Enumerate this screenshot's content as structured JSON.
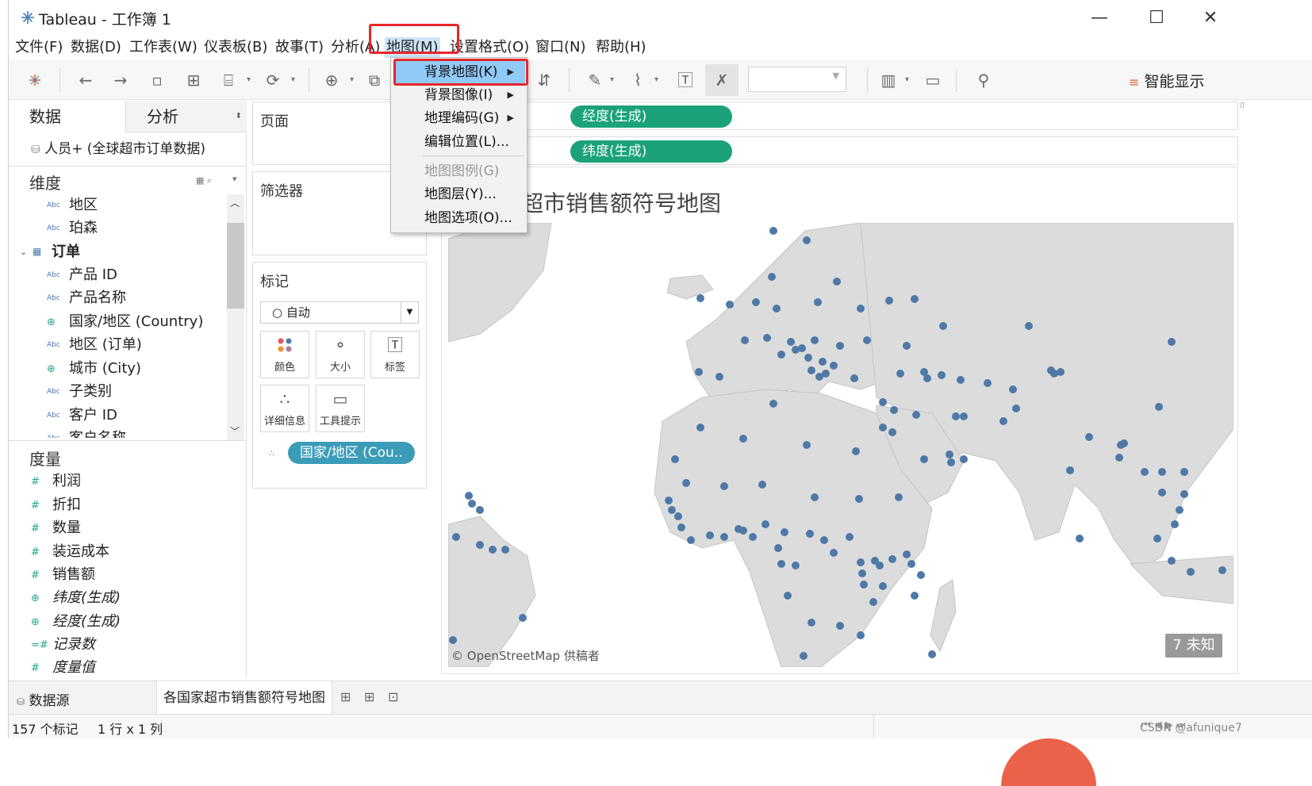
{
  "window": {
    "title": "Tableau - 工作簿 1",
    "controls": {
      "minimize": "—",
      "maximize": "☐",
      "close": "✕"
    }
  },
  "menubar": {
    "items": [
      "文件(F)",
      "数据(D)",
      "工作表(W)",
      "仪表板(B)",
      "故事(T)",
      "分析(A)",
      "地图(M)",
      "设置格式(O)",
      "窗口(N)",
      "帮助(H)"
    ],
    "active": "地图(M)"
  },
  "toolbar": {
    "smart_display": "智能显示",
    "icons": [
      "tableau-logo-icon",
      "undo-icon",
      "redo-icon",
      "save-icon",
      "new-datasource-icon",
      "pause-updates-icon",
      "refresh-icon",
      "new-worksheet-icon",
      "duplicate-icon",
      "sort-desc-icon",
      "highlight-icon",
      "paperclip-icon",
      "text-label-icon",
      "clear-pin-icon",
      "fit-dropdown",
      "show-cards-icon",
      "presentation-icon",
      "share-icon"
    ]
  },
  "map_menu": {
    "items": [
      {
        "label": "背景地图(K)",
        "submenu": true,
        "highlighted": true,
        "disabled": false
      },
      {
        "label": "背景图像(I)",
        "submenu": true,
        "highlighted": false,
        "disabled": false
      },
      {
        "label": "地理编码(G)",
        "submenu": true,
        "highlighted": false,
        "disabled": false
      },
      {
        "label": "编辑位置(L)...",
        "submenu": false,
        "highlighted": false,
        "disabled": false
      },
      {
        "label": "地图图例(G)",
        "submenu": false,
        "highlighted": false,
        "disabled": true
      },
      {
        "label": "地图层(Y)...",
        "submenu": false,
        "highlighted": false,
        "disabled": false
      },
      {
        "label": "地图选项(O)...",
        "submenu": false,
        "highlighted": false,
        "disabled": false
      }
    ]
  },
  "data_pane": {
    "tabs": [
      "数据",
      "分析"
    ],
    "datasource": "人员+ (全球超市订单数据)",
    "dimensions_title": "维度",
    "dimensions": [
      {
        "name": "地区",
        "type": "Abc",
        "indent": 1
      },
      {
        "name": "珀森",
        "type": "Abc",
        "indent": 1
      },
      {
        "name": "订单",
        "type": "table",
        "indent": 0,
        "bold": true
      },
      {
        "name": "产品 ID",
        "type": "Abc",
        "indent": 1
      },
      {
        "name": "产品名称",
        "type": "Abc",
        "indent": 1
      },
      {
        "name": "国家/地区 (Country)",
        "type": "globe",
        "indent": 1
      },
      {
        "name": "地区 (订单)",
        "type": "Abc",
        "indent": 1
      },
      {
        "name": "城市 (City)",
        "type": "globe",
        "indent": 1
      },
      {
        "name": "子类别",
        "type": "Abc",
        "indent": 1
      },
      {
        "name": "客户 ID",
        "type": "Abc",
        "indent": 1
      },
      {
        "name": "客户名称",
        "type": "Abc",
        "indent": 1
      }
    ],
    "measures_title": "度量",
    "measures": [
      {
        "name": "利润",
        "type": "#",
        "italic": false
      },
      {
        "name": "折扣",
        "type": "#",
        "italic": false
      },
      {
        "name": "数量",
        "type": "#",
        "italic": false
      },
      {
        "name": "装运成本",
        "type": "#",
        "italic": false
      },
      {
        "name": "销售额",
        "type": "#",
        "italic": false
      },
      {
        "name": "纬度(生成)",
        "type": "globe",
        "italic": true
      },
      {
        "name": "经度(生成)",
        "type": "globe",
        "italic": true
      },
      {
        "name": "记录数",
        "type": "=#",
        "italic": true
      },
      {
        "name": "度量值",
        "type": "#",
        "italic": true
      }
    ]
  },
  "shelves": {
    "pages_title": "页面",
    "filters_title": "筛选器",
    "marks_title": "标记",
    "mark_type": "○ 自动",
    "mark_buttons": [
      "颜色",
      "大小",
      "标签",
      "详细信息",
      "工具提示"
    ],
    "detail_pill": "国家/地区 (Cou..",
    "columns_pill": "经度(生成)",
    "rows_pill": "纬度(生成)"
  },
  "view": {
    "title": "各国家超市销售额符号地图",
    "title_visible": "超市销售额符号地图",
    "attribution": "© OpenStreetMap 供稿者",
    "unknown_badge": "7 未知",
    "point_color": "#4e79a7"
  },
  "sheet_tabs": {
    "datasource": "数据源",
    "active_sheet": "各国家超市销售额符号地图"
  },
  "status": {
    "marks": "157 个标记",
    "rows_cols": "1 行 x 1 列"
  },
  "watermark": "CSDN @afunique7",
  "colors": {
    "pill_green": "#1ba27a",
    "pill_teal": "#3b9cb8",
    "highlight_red": "#e8262a",
    "menu_highlight": "#91c9f7"
  }
}
